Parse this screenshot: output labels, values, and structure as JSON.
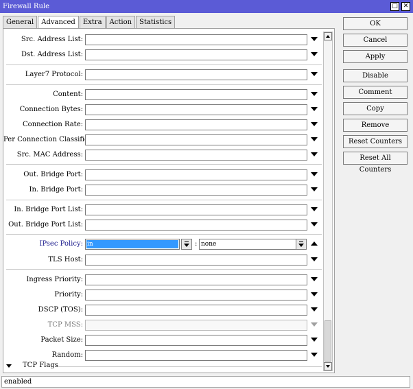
{
  "window": {
    "title": "Firewall Rule"
  },
  "tabs": [
    {
      "label": "General",
      "active": false
    },
    {
      "label": "Advanced",
      "active": true
    },
    {
      "label": "Extra",
      "active": false
    },
    {
      "label": "Action",
      "active": false
    },
    {
      "label": "Statistics",
      "active": false
    }
  ],
  "fields": {
    "src_address_list": {
      "label": "Src. Address List:",
      "value": ""
    },
    "dst_address_list": {
      "label": "Dst. Address List:",
      "value": ""
    },
    "layer7_protocol": {
      "label": "Layer7 Protocol:",
      "value": ""
    },
    "content": {
      "label": "Content:",
      "value": ""
    },
    "connection_bytes": {
      "label": "Connection Bytes:",
      "value": ""
    },
    "connection_rate": {
      "label": "Connection Rate:",
      "value": ""
    },
    "per_connection_classifier": {
      "label": "Per Connection Classifier:",
      "value": ""
    },
    "src_mac_address": {
      "label": "Src. MAC Address:",
      "value": ""
    },
    "out_bridge_port": {
      "label": "Out. Bridge Port:",
      "value": ""
    },
    "in_bridge_port": {
      "label": "In. Bridge Port:",
      "value": ""
    },
    "in_bridge_port_list": {
      "label": "In. Bridge Port List:",
      "value": ""
    },
    "out_bridge_port_list": {
      "label": "Out. Bridge Port List:",
      "value": ""
    },
    "ipsec_policy": {
      "label": "IPsec Policy:",
      "direction": "in",
      "separator": ":",
      "policy": "none"
    },
    "tls_host": {
      "label": "TLS Host:",
      "value": ""
    },
    "ingress_priority": {
      "label": "Ingress Priority:",
      "value": ""
    },
    "priority": {
      "label": "Priority:",
      "value": ""
    },
    "dscp": {
      "label": "DSCP (TOS):",
      "value": ""
    },
    "tcp_mss": {
      "label": "TCP MSS:",
      "value": ""
    },
    "packet_size": {
      "label": "Packet Size:",
      "value": ""
    },
    "random": {
      "label": "Random:",
      "value": ""
    }
  },
  "sections": {
    "tcp_flags": "TCP Flags"
  },
  "buttons": {
    "ok": "OK",
    "cancel": "Cancel",
    "apply": "Apply",
    "disable": "Disable",
    "comment": "Comment",
    "copy": "Copy",
    "remove": "Remove",
    "reset_counters": "Reset Counters",
    "reset_all_counters": "Reset All Counters"
  },
  "status": {
    "text": "enabled"
  },
  "colors": {
    "titlebar": "#5b5bd6",
    "selection": "#3399ff"
  }
}
